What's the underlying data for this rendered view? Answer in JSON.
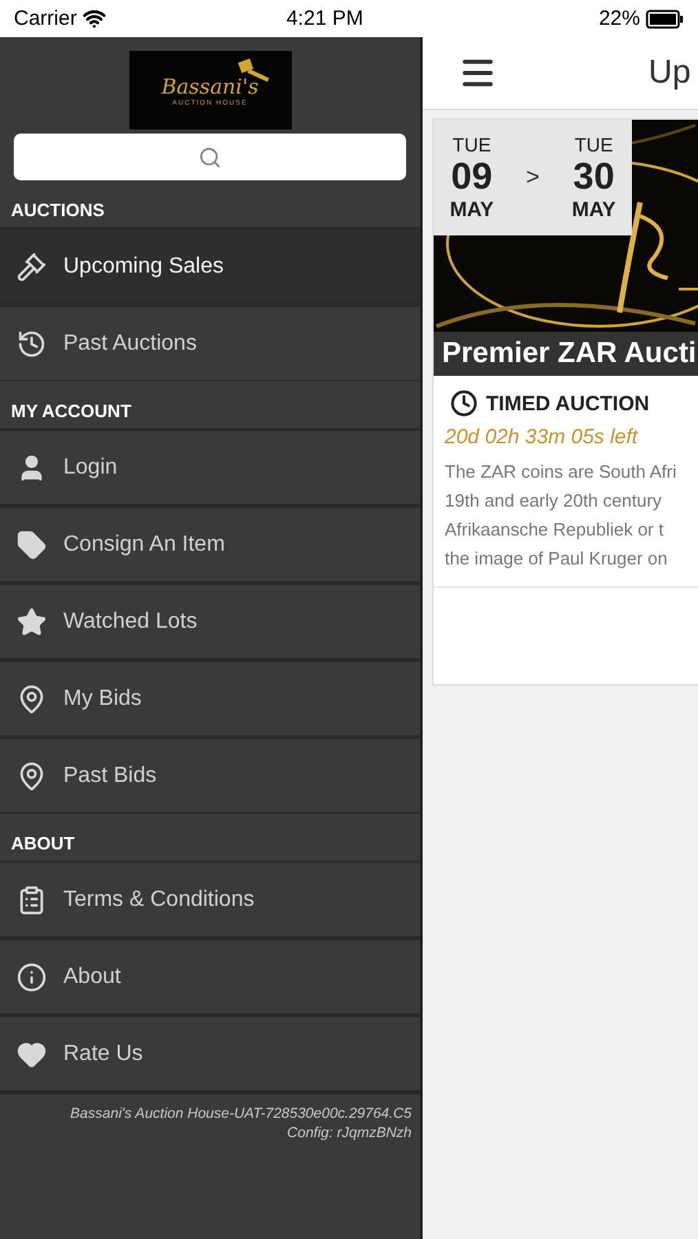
{
  "status_bar": {
    "carrier": "Carrier",
    "time": "4:21 PM",
    "battery": "22%"
  },
  "sidebar": {
    "logo": {
      "script": "Bassani's",
      "subtitle": "AUCTION HOUSE"
    },
    "sections": [
      {
        "title": "AUCTIONS",
        "items": [
          {
            "label": "Upcoming Sales",
            "selected": true
          },
          {
            "label": "Past Auctions",
            "selected": false
          }
        ]
      },
      {
        "title": "MY ACCOUNT",
        "items": [
          {
            "label": "Login",
            "selected": false
          },
          {
            "label": "Consign An Item",
            "selected": false
          },
          {
            "label": "Watched Lots",
            "selected": false
          },
          {
            "label": "My Bids",
            "selected": false
          },
          {
            "label": "Past Bids",
            "selected": false
          }
        ]
      },
      {
        "title": "ABOUT",
        "items": [
          {
            "label": "Terms & Conditions",
            "selected": false
          },
          {
            "label": "About",
            "selected": false
          },
          {
            "label": "Rate Us",
            "selected": false
          }
        ]
      }
    ],
    "footer": [
      "Bassani's Auction House-UAT-728530e00c.29764.C5",
      "Config: rJqmzBNzh"
    ]
  },
  "header": {
    "title": "Up"
  },
  "auctions": [
    {
      "start": {
        "weekday": "TUE",
        "day": "09",
        "month": "MAY"
      },
      "separator": ">",
      "end": {
        "weekday": "TUE",
        "day": "30",
        "month": "MAY"
      },
      "title": "Premier ZAR Aucti",
      "type": "TIMED AUCTION",
      "countdown": "20d 02h 33m 05s left",
      "description": [
        "The ZAR coins are South Afri",
        "19th and early 20th century",
        "Afrikaansche Republiek or t",
        "the image of Paul Kruger on"
      ]
    }
  ]
}
